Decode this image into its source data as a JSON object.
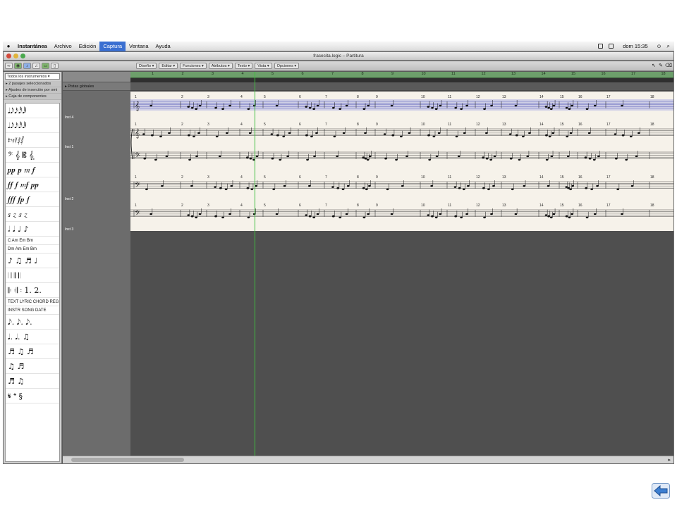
{
  "menubar": {
    "app": "Instantánea",
    "items": [
      "Archivo",
      "Edición",
      "Captura",
      "Ventana",
      "Ayuda"
    ],
    "active_index": 2,
    "clock": "dom 15:35"
  },
  "window": {
    "title": "frasecita.logic – Partitura"
  },
  "toolbar": {
    "menus": [
      "Diseño ▾",
      "Editar ▾",
      "Funciones ▾",
      "Atributos ▾",
      "Texto ▾",
      "Vista ▾",
      "Opciones ▾"
    ]
  },
  "inspector": {
    "selector": "Todos los instrumentos ▾",
    "sections": [
      "▸ 2 pasajes seleccionados",
      "▸ Ajustes de inserción por omi",
      "▸ Caja de componentes"
    ],
    "palette_rows": [
      "𝅘𝅥𝅘𝅥𝅮𝅘𝅥𝅯𝅘𝅥𝅰𝅘𝅥𝅱",
      "𝅘𝅥𝅘𝅥𝅮𝅘𝅥𝅯𝅘𝅥𝅰𝅘𝅥𝅱",
      "𝄽𝄾𝄿𝅀𝅁𝅂",
      "𝄢 𝄞 𝄡 𝄠",
      "𝆏𝆏 𝆏 𝆐 𝆑",
      "𝆑𝆑 𝆑 𝆐𝆑 𝆏𝆏",
      "𝆑𝆑𝆑 𝆑𝆏 𝆑",
      "𝆍 𝆎 𝆍 𝆎",
      "𝅗𝅥 𝅘𝅥 ♩ ♪",
      "C Am Em Bm",
      "Dm Am Em Bm",
      "♪ ♫ ♬ ♩",
      "𝄀 𝄁 𝄂 𝄃",
      "𝄆 𝄇 𝄈 1. 2.",
      "𝅘𝅥𝅮. 𝅘𝅥𝅮. 𝅘𝅥𝅮.",
      "𝅘𝅥. 𝅘𝅥. ♫",
      "♬ ♫ ♬",
      "♫ ♬",
      "♬ ♫",
      "𝄋 𝄌 §"
    ],
    "text_items": [
      "TEXT LYRIC CHORD REGION",
      "INSTR SONG DATE"
    ]
  },
  "tracks": {
    "global_label": "▸ Pistas globales",
    "labels": [
      "Inst 4",
      "Inst 1",
      "Inst 2",
      "Inst 3"
    ]
  },
  "ruler": {
    "bars": [
      "1",
      "2",
      "3",
      "4",
      "5",
      "6",
      "7",
      "8",
      "9",
      "10",
      "11",
      "12",
      "13",
      "14",
      "15",
      "16",
      "17",
      "18"
    ]
  },
  "score": {
    "bar_numbers": [
      "1",
      "2",
      "3",
      "4",
      "5",
      "6",
      "7",
      "8",
      "9",
      "10",
      "11",
      "12",
      "13",
      "14",
      "15",
      "16",
      "17",
      "18"
    ]
  },
  "colors": {
    "ruler": "#6d9f6b",
    "paper": "#f6f2ea",
    "playhead": "#3fbf3f",
    "highlight_staff": "#8a8ee0",
    "menubar_active": "#3a6fd1"
  }
}
